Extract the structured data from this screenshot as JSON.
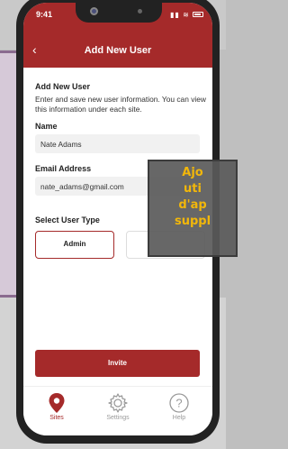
{
  "status_bar": {
    "time": "9:41"
  },
  "header": {
    "title": "Add New User"
  },
  "form": {
    "section_title": "Add New User",
    "description": "Enter and save new user information. You can view this information under each site.",
    "name_label": "Name",
    "name_value": "Nate Adams",
    "email_label": "Email Address",
    "email_value": "nate_adams@gmail.com",
    "user_type_label": "Select User Type",
    "user_types": [
      "Admin"
    ]
  },
  "invite_button": "Invite",
  "tabs": [
    {
      "label": "Sites",
      "icon": "location-pin-icon",
      "active": true
    },
    {
      "label": "Settings",
      "icon": "gear-icon",
      "active": false
    },
    {
      "label": "Help",
      "icon": "help-icon",
      "active": false
    }
  ],
  "overlay": {
    "lines": [
      "Ajo",
      "uti",
      "d'ap",
      "suppl"
    ]
  },
  "colors": {
    "accent": "#a52a2a",
    "overlay_text": "#f2b70a"
  }
}
